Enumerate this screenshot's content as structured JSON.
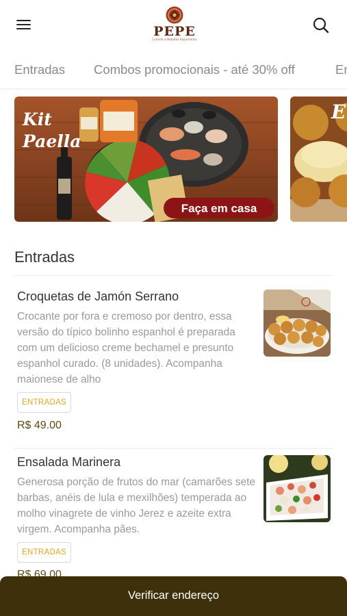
{
  "header": {
    "logo_text": "PEPE",
    "logo_subtitle": "Comida e Bebidas Espanholas",
    "icons": {
      "menu": "hamburger-menu-icon",
      "search": "search-icon"
    }
  },
  "tabs": [
    {
      "label": "Entradas"
    },
    {
      "label": "Combos promocionais - até 30% off"
    },
    {
      "label": "En"
    }
  ],
  "banners": [
    {
      "title_line1": "Kit",
      "title_line2": "Paella",
      "cta": "Faça em casa"
    },
    {
      "title_fragment": "E"
    }
  ],
  "section": {
    "title": "Entradas"
  },
  "items": [
    {
      "name": "Croquetas de Jamón Serrano",
      "description": "Crocante por fora e cremoso por dentro, essa versão do típico bolinho espanhol é preparada com um delicioso creme bechamel e presunto espanhol curado. (8 unidades). Acompanha maionese de alho",
      "tag": "ENTRADAS",
      "price": "R$ 49.00"
    },
    {
      "name": "Ensalada Marinera",
      "description": "Generosa porção de frutos do mar (camarões sete barbas, anéis de lula e mexilhões) temperada ao molho vinagrete de vinho Jerez e azeite extra virgem. Acompanha pães.",
      "tag": "ENTRADAS",
      "price": "R$ 69.00"
    }
  ],
  "bottom_bar": {
    "label": "Verificar endereço"
  },
  "colors": {
    "brand_dark": "#3d300a",
    "tag_text": "#e9a51e",
    "price_text": "#5a4a10",
    "banner_cta_bg": "#8c1414"
  }
}
